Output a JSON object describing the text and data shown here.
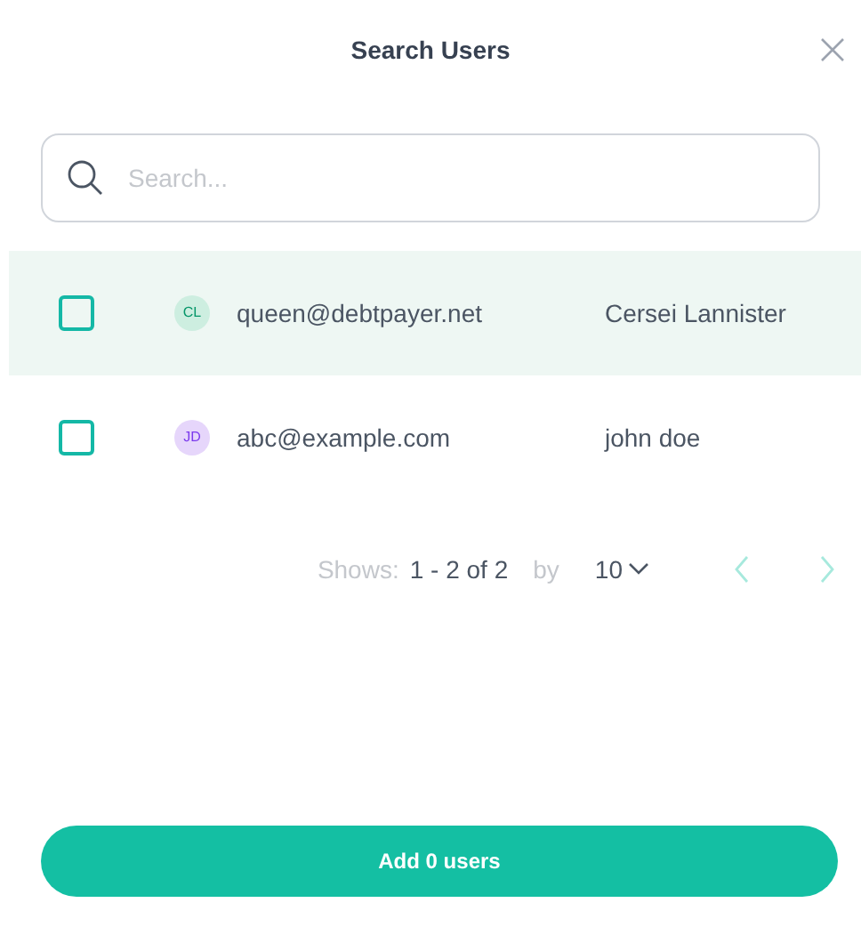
{
  "dialog": {
    "title": "Search Users"
  },
  "search": {
    "placeholder": "Search..."
  },
  "users": [
    {
      "initials": "CL",
      "color": "#cdeee0",
      "email": "queen@debtpayer.net",
      "name": "Cersei Lannister",
      "checked": false,
      "highlighted": true
    },
    {
      "initials": "JD",
      "color": "#e6d6fb",
      "email": "abc@example.com",
      "name": "john doe",
      "checked": false,
      "highlighted": false
    }
  ],
  "pagination": {
    "shows_label": "Shows:",
    "range": "1 - 2 of 2",
    "by_label": "by",
    "page_size": "10",
    "prev_disabled": true,
    "next_disabled": true
  },
  "add_button": "Add 0 users"
}
